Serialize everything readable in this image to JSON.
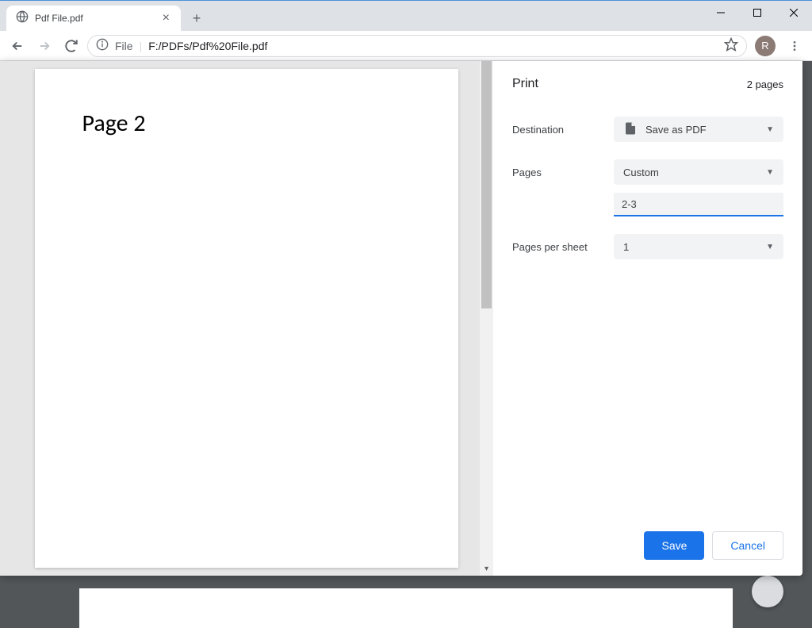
{
  "tab": {
    "title": "Pdf File.pdf"
  },
  "address": {
    "file_label": "File",
    "url": "F:/PDFs/Pdf%20File.pdf"
  },
  "avatar_letter": "R",
  "preview": {
    "heading": "Page 2"
  },
  "print": {
    "title": "Print",
    "page_count": "2 pages",
    "destination_label": "Destination",
    "destination_value": "Save as PDF",
    "pages_label": "Pages",
    "pages_mode": "Custom",
    "pages_range": "2-3",
    "pps_label": "Pages per sheet",
    "pps_value": "1",
    "save_btn": "Save",
    "cancel_btn": "Cancel"
  }
}
